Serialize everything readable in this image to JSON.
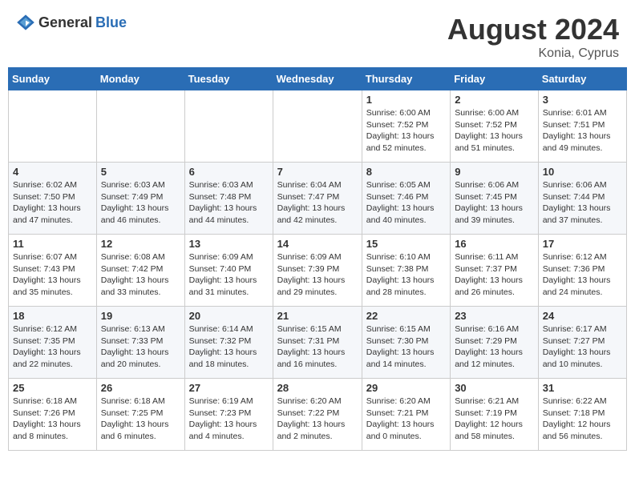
{
  "header": {
    "logo_general": "General",
    "logo_blue": "Blue",
    "month_year": "August 2024",
    "location": "Konia, Cyprus"
  },
  "weekdays": [
    "Sunday",
    "Monday",
    "Tuesday",
    "Wednesday",
    "Thursday",
    "Friday",
    "Saturday"
  ],
  "weeks": [
    [
      {
        "day": "",
        "sunrise": "",
        "sunset": "",
        "daylight": ""
      },
      {
        "day": "",
        "sunrise": "",
        "sunset": "",
        "daylight": ""
      },
      {
        "day": "",
        "sunrise": "",
        "sunset": "",
        "daylight": ""
      },
      {
        "day": "",
        "sunrise": "",
        "sunset": "",
        "daylight": ""
      },
      {
        "day": "1",
        "sunrise": "Sunrise: 6:00 AM",
        "sunset": "Sunset: 7:52 PM",
        "daylight": "Daylight: 13 hours and 52 minutes."
      },
      {
        "day": "2",
        "sunrise": "Sunrise: 6:00 AM",
        "sunset": "Sunset: 7:52 PM",
        "daylight": "Daylight: 13 hours and 51 minutes."
      },
      {
        "day": "3",
        "sunrise": "Sunrise: 6:01 AM",
        "sunset": "Sunset: 7:51 PM",
        "daylight": "Daylight: 13 hours and 49 minutes."
      }
    ],
    [
      {
        "day": "4",
        "sunrise": "Sunrise: 6:02 AM",
        "sunset": "Sunset: 7:50 PM",
        "daylight": "Daylight: 13 hours and 47 minutes."
      },
      {
        "day": "5",
        "sunrise": "Sunrise: 6:03 AM",
        "sunset": "Sunset: 7:49 PM",
        "daylight": "Daylight: 13 hours and 46 minutes."
      },
      {
        "day": "6",
        "sunrise": "Sunrise: 6:03 AM",
        "sunset": "Sunset: 7:48 PM",
        "daylight": "Daylight: 13 hours and 44 minutes."
      },
      {
        "day": "7",
        "sunrise": "Sunrise: 6:04 AM",
        "sunset": "Sunset: 7:47 PM",
        "daylight": "Daylight: 13 hours and 42 minutes."
      },
      {
        "day": "8",
        "sunrise": "Sunrise: 6:05 AM",
        "sunset": "Sunset: 7:46 PM",
        "daylight": "Daylight: 13 hours and 40 minutes."
      },
      {
        "day": "9",
        "sunrise": "Sunrise: 6:06 AM",
        "sunset": "Sunset: 7:45 PM",
        "daylight": "Daylight: 13 hours and 39 minutes."
      },
      {
        "day": "10",
        "sunrise": "Sunrise: 6:06 AM",
        "sunset": "Sunset: 7:44 PM",
        "daylight": "Daylight: 13 hours and 37 minutes."
      }
    ],
    [
      {
        "day": "11",
        "sunrise": "Sunrise: 6:07 AM",
        "sunset": "Sunset: 7:43 PM",
        "daylight": "Daylight: 13 hours and 35 minutes."
      },
      {
        "day": "12",
        "sunrise": "Sunrise: 6:08 AM",
        "sunset": "Sunset: 7:42 PM",
        "daylight": "Daylight: 13 hours and 33 minutes."
      },
      {
        "day": "13",
        "sunrise": "Sunrise: 6:09 AM",
        "sunset": "Sunset: 7:40 PM",
        "daylight": "Daylight: 13 hours and 31 minutes."
      },
      {
        "day": "14",
        "sunrise": "Sunrise: 6:09 AM",
        "sunset": "Sunset: 7:39 PM",
        "daylight": "Daylight: 13 hours and 29 minutes."
      },
      {
        "day": "15",
        "sunrise": "Sunrise: 6:10 AM",
        "sunset": "Sunset: 7:38 PM",
        "daylight": "Daylight: 13 hours and 28 minutes."
      },
      {
        "day": "16",
        "sunrise": "Sunrise: 6:11 AM",
        "sunset": "Sunset: 7:37 PM",
        "daylight": "Daylight: 13 hours and 26 minutes."
      },
      {
        "day": "17",
        "sunrise": "Sunrise: 6:12 AM",
        "sunset": "Sunset: 7:36 PM",
        "daylight": "Daylight: 13 hours and 24 minutes."
      }
    ],
    [
      {
        "day": "18",
        "sunrise": "Sunrise: 6:12 AM",
        "sunset": "Sunset: 7:35 PM",
        "daylight": "Daylight: 13 hours and 22 minutes."
      },
      {
        "day": "19",
        "sunrise": "Sunrise: 6:13 AM",
        "sunset": "Sunset: 7:33 PM",
        "daylight": "Daylight: 13 hours and 20 minutes."
      },
      {
        "day": "20",
        "sunrise": "Sunrise: 6:14 AM",
        "sunset": "Sunset: 7:32 PM",
        "daylight": "Daylight: 13 hours and 18 minutes."
      },
      {
        "day": "21",
        "sunrise": "Sunrise: 6:15 AM",
        "sunset": "Sunset: 7:31 PM",
        "daylight": "Daylight: 13 hours and 16 minutes."
      },
      {
        "day": "22",
        "sunrise": "Sunrise: 6:15 AM",
        "sunset": "Sunset: 7:30 PM",
        "daylight": "Daylight: 13 hours and 14 minutes."
      },
      {
        "day": "23",
        "sunrise": "Sunrise: 6:16 AM",
        "sunset": "Sunset: 7:29 PM",
        "daylight": "Daylight: 13 hours and 12 minutes."
      },
      {
        "day": "24",
        "sunrise": "Sunrise: 6:17 AM",
        "sunset": "Sunset: 7:27 PM",
        "daylight": "Daylight: 13 hours and 10 minutes."
      }
    ],
    [
      {
        "day": "25",
        "sunrise": "Sunrise: 6:18 AM",
        "sunset": "Sunset: 7:26 PM",
        "daylight": "Daylight: 13 hours and 8 minutes."
      },
      {
        "day": "26",
        "sunrise": "Sunrise: 6:18 AM",
        "sunset": "Sunset: 7:25 PM",
        "daylight": "Daylight: 13 hours and 6 minutes."
      },
      {
        "day": "27",
        "sunrise": "Sunrise: 6:19 AM",
        "sunset": "Sunset: 7:23 PM",
        "daylight": "Daylight: 13 hours and 4 minutes."
      },
      {
        "day": "28",
        "sunrise": "Sunrise: 6:20 AM",
        "sunset": "Sunset: 7:22 PM",
        "daylight": "Daylight: 13 hours and 2 minutes."
      },
      {
        "day": "29",
        "sunrise": "Sunrise: 6:20 AM",
        "sunset": "Sunset: 7:21 PM",
        "daylight": "Daylight: 13 hours and 0 minutes."
      },
      {
        "day": "30",
        "sunrise": "Sunrise: 6:21 AM",
        "sunset": "Sunset: 7:19 PM",
        "daylight": "Daylight: 12 hours and 58 minutes."
      },
      {
        "day": "31",
        "sunrise": "Sunrise: 6:22 AM",
        "sunset": "Sunset: 7:18 PM",
        "daylight": "Daylight: 12 hours and 56 minutes."
      }
    ]
  ]
}
